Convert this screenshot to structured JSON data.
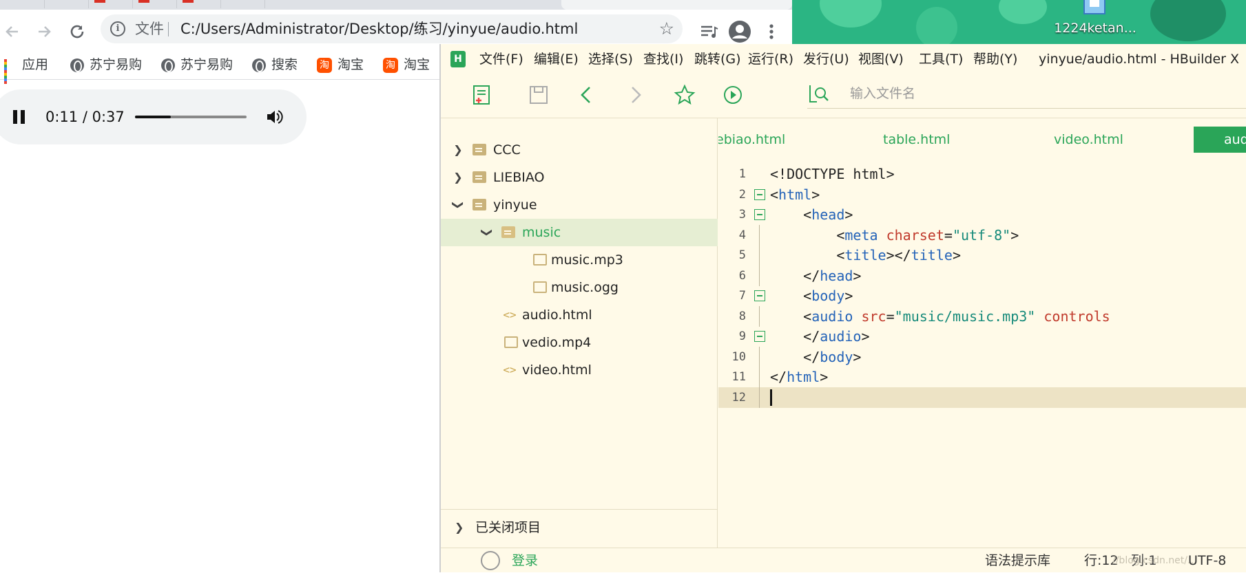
{
  "browser": {
    "tab_fragments": [
      "",
      "",
      "",
      "",
      "",
      ""
    ],
    "nav": {
      "back_icon": "back-arrow-icon",
      "forward_icon": "forward-arrow-icon",
      "reload_icon": "reload-icon"
    },
    "omnibox": {
      "scheme_label": "文件",
      "url": "C:/Users/Administrator/Desktop/练习/yinyue/audio.html"
    },
    "bookmarks": [
      {
        "label": "应用",
        "icon": "apps-grid-icon"
      },
      {
        "label": "苏宁易购",
        "icon": "globe-icon"
      },
      {
        "label": "苏宁易购",
        "icon": "globe-icon"
      },
      {
        "label": "搜索",
        "icon": "globe-icon"
      },
      {
        "label": "淘宝",
        "icon": "taobao-icon",
        "glyph": "淘"
      },
      {
        "label": "淘宝",
        "icon": "taobao-icon",
        "glyph": "淘"
      }
    ],
    "audio": {
      "state": "playing",
      "time": "0:11 / 0:37",
      "progress": 0.32
    }
  },
  "desktop": {
    "icon_label": "1224ketan...",
    "color": "#2bb583"
  },
  "hbuilder": {
    "logo": "H",
    "menu": [
      "文件(F)",
      "编辑(E)",
      "选择(S)",
      "查找(I)",
      "跳转(G)",
      "运行(R)",
      "发行(U)",
      "视图(V)",
      "工具(T)",
      "帮助(Y)"
    ],
    "window_title": "yinyue/audio.html - HBuilder X",
    "search_placeholder": "输入文件名",
    "tree": [
      {
        "label": "CCC",
        "type": "folder",
        "expanded": false
      },
      {
        "label": "LIEBIAO",
        "type": "folder",
        "expanded": false
      },
      {
        "label": "yinyue",
        "type": "folder",
        "expanded": true
      },
      {
        "label": "music",
        "type": "folder-open",
        "expanded": true,
        "selected": true
      },
      {
        "label": "music.mp3",
        "type": "file"
      },
      {
        "label": "music.ogg",
        "type": "file"
      },
      {
        "label": "audio.html",
        "type": "code"
      },
      {
        "label": "vedio.mp4",
        "type": "file"
      },
      {
        "label": "video.html",
        "type": "code"
      }
    ],
    "closed_projects": "已关闭项目",
    "tabs": [
      "ebiao.html",
      "table.html",
      "video.html",
      "aud"
    ],
    "code_lines": [
      {
        "n": "1",
        "tokens": [
          [
            "p",
            "<!DOCTYPE html>"
          ]
        ]
      },
      {
        "n": "2",
        "tokens": [
          [
            "p",
            "<"
          ],
          [
            "tg",
            "html"
          ],
          [
            "p",
            ">"
          ]
        ]
      },
      {
        "n": "3",
        "tokens": [
          [
            "p",
            "    <"
          ],
          [
            "tg",
            "head"
          ],
          [
            "p",
            ">"
          ]
        ]
      },
      {
        "n": "4",
        "tokens": [
          [
            "p",
            "        <"
          ],
          [
            "tg",
            "meta "
          ],
          [
            "at",
            "charset"
          ],
          [
            "p",
            "="
          ],
          [
            "st",
            "\"utf-8\""
          ],
          [
            "p",
            ">"
          ]
        ]
      },
      {
        "n": "5",
        "tokens": [
          [
            "p",
            "        <"
          ],
          [
            "tg",
            "title"
          ],
          [
            "p",
            "></"
          ],
          [
            "tg",
            "title"
          ],
          [
            "p",
            ">"
          ]
        ]
      },
      {
        "n": "6",
        "tokens": [
          [
            "p",
            "    </"
          ],
          [
            "tg",
            "head"
          ],
          [
            "p",
            ">"
          ]
        ]
      },
      {
        "n": "7",
        "tokens": [
          [
            "p",
            "    <"
          ],
          [
            "tg",
            "body"
          ],
          [
            "p",
            ">"
          ]
        ]
      },
      {
        "n": "8",
        "tokens": [
          [
            "p",
            "    <"
          ],
          [
            "tg",
            "audio "
          ],
          [
            "at",
            "src"
          ],
          [
            "p",
            "="
          ],
          [
            "st",
            "\"music/music.mp3\""
          ],
          [
            "p",
            " "
          ],
          [
            "at",
            "controls"
          ]
        ]
      },
      {
        "n": "9",
        "tokens": [
          [
            "p",
            "    </"
          ],
          [
            "tg",
            "audio"
          ],
          [
            "p",
            ">"
          ]
        ]
      },
      {
        "n": "10",
        "tokens": [
          [
            "p",
            "    </"
          ],
          [
            "tg",
            "body"
          ],
          [
            "p",
            ">"
          ]
        ]
      },
      {
        "n": "11",
        "tokens": [
          [
            "p",
            "</"
          ],
          [
            "tg",
            "html"
          ],
          [
            "p",
            ">"
          ]
        ]
      },
      {
        "n": "12",
        "tokens": []
      }
    ],
    "status": {
      "login": "登录",
      "syntax_lib": "语法提示库",
      "line": "行:12",
      "col": "列:1",
      "encoding": "UTF-8",
      "watermark": "//blog.csdn.net/..."
    },
    "accent": "#2aa558"
  }
}
